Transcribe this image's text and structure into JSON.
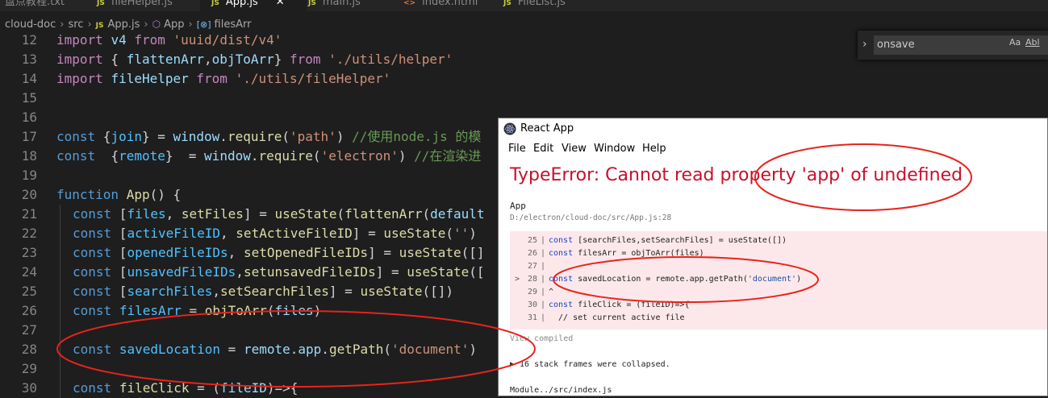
{
  "tabs": [
    {
      "label": "盘点教程.txt",
      "icon": ""
    },
    {
      "label": "fileHelper.js",
      "icon": "JS"
    },
    {
      "label": "App.js",
      "icon": "JS",
      "active": true,
      "close": "✕"
    },
    {
      "label": "main.js",
      "icon": "JS"
    },
    {
      "label": "index.html",
      "icon": "<>"
    },
    {
      "label": "FileList.js",
      "icon": "JS"
    }
  ],
  "breadcrumb": {
    "root": "cloud-doc",
    "folder": "src",
    "file_icon": "JS",
    "file": "App.js",
    "component": "App",
    "symbol": "filesArr"
  },
  "find_widget": {
    "value": "onsave",
    "match_case": "Aa",
    "whole_word": "Abl"
  },
  "editor_lines": [
    {
      "n": "12",
      "text": "import v4 from 'uuid/dist/v4'"
    },
    {
      "n": "13",
      "text": "import { flattenArr,objToArr} from './utils/helper'"
    },
    {
      "n": "14",
      "text": "import fileHelper from './utils/fileHelper'"
    },
    {
      "n": "15",
      "text": ""
    },
    {
      "n": "16",
      "text": ""
    },
    {
      "n": "17",
      "text": "const {join} = window.require('path') //使用node.js 的模"
    },
    {
      "n": "18",
      "text": "const  {remote}  = window.require('electron') //在渲染进"
    },
    {
      "n": "19",
      "text": ""
    },
    {
      "n": "20",
      "text": "function App() {"
    },
    {
      "n": "21",
      "text": "const [files, setFiles] = useState(flattenArr(default"
    },
    {
      "n": "22",
      "text": "const [activeFileID, setActiveFileID] = useState('')"
    },
    {
      "n": "23",
      "text": "const [openedFileIDs, setOpenedFileIDs] = useState([]"
    },
    {
      "n": "24",
      "text": "const [unsavedFileIDs,setunsavedFileIDs] = useState(["
    },
    {
      "n": "25",
      "text": "const [searchFiles,setSearchFiles] = useState([])"
    },
    {
      "n": "26",
      "text": "const filesArr = objToArr(files)"
    },
    {
      "n": "27",
      "text": ""
    },
    {
      "n": "28",
      "text": "const savedLocation = remote.app.getPath('document')"
    },
    {
      "n": "29",
      "text": ""
    },
    {
      "n": "30",
      "text": "const fileClick = (fileID)=>{"
    }
  ],
  "react_window": {
    "title": "React App",
    "menu": [
      "File",
      "Edit",
      "View",
      "Window",
      "Help"
    ],
    "error_title": "TypeError: Cannot read property 'app' of undefined",
    "component": "App",
    "file_path": "D:/electron/cloud-doc/src/App.js:28",
    "code": [
      {
        "marker": "",
        "n": "25",
        "text": "const [searchFiles,setSearchFiles] = useState([])"
      },
      {
        "marker": "",
        "n": "26",
        "text": "const filesArr = objToArr(files)"
      },
      {
        "marker": "",
        "n": "27",
        "text": ""
      },
      {
        "marker": ">",
        "n": "28",
        "text": "const savedLocation = remote.app.getPath('document')"
      },
      {
        "marker": "",
        "n": "29",
        "text": "^"
      },
      {
        "marker": "",
        "n": "30",
        "text": "const fileClick = (fileID)=>{"
      },
      {
        "marker": "",
        "n": "31",
        "text": "  // set current active file"
      }
    ],
    "view_compiled": "View compiled",
    "frames_collapsed": "▶ 16 stack frames were collapsed.",
    "module_line": "Module../src/index.js"
  },
  "annotation_color": "#e8231b"
}
